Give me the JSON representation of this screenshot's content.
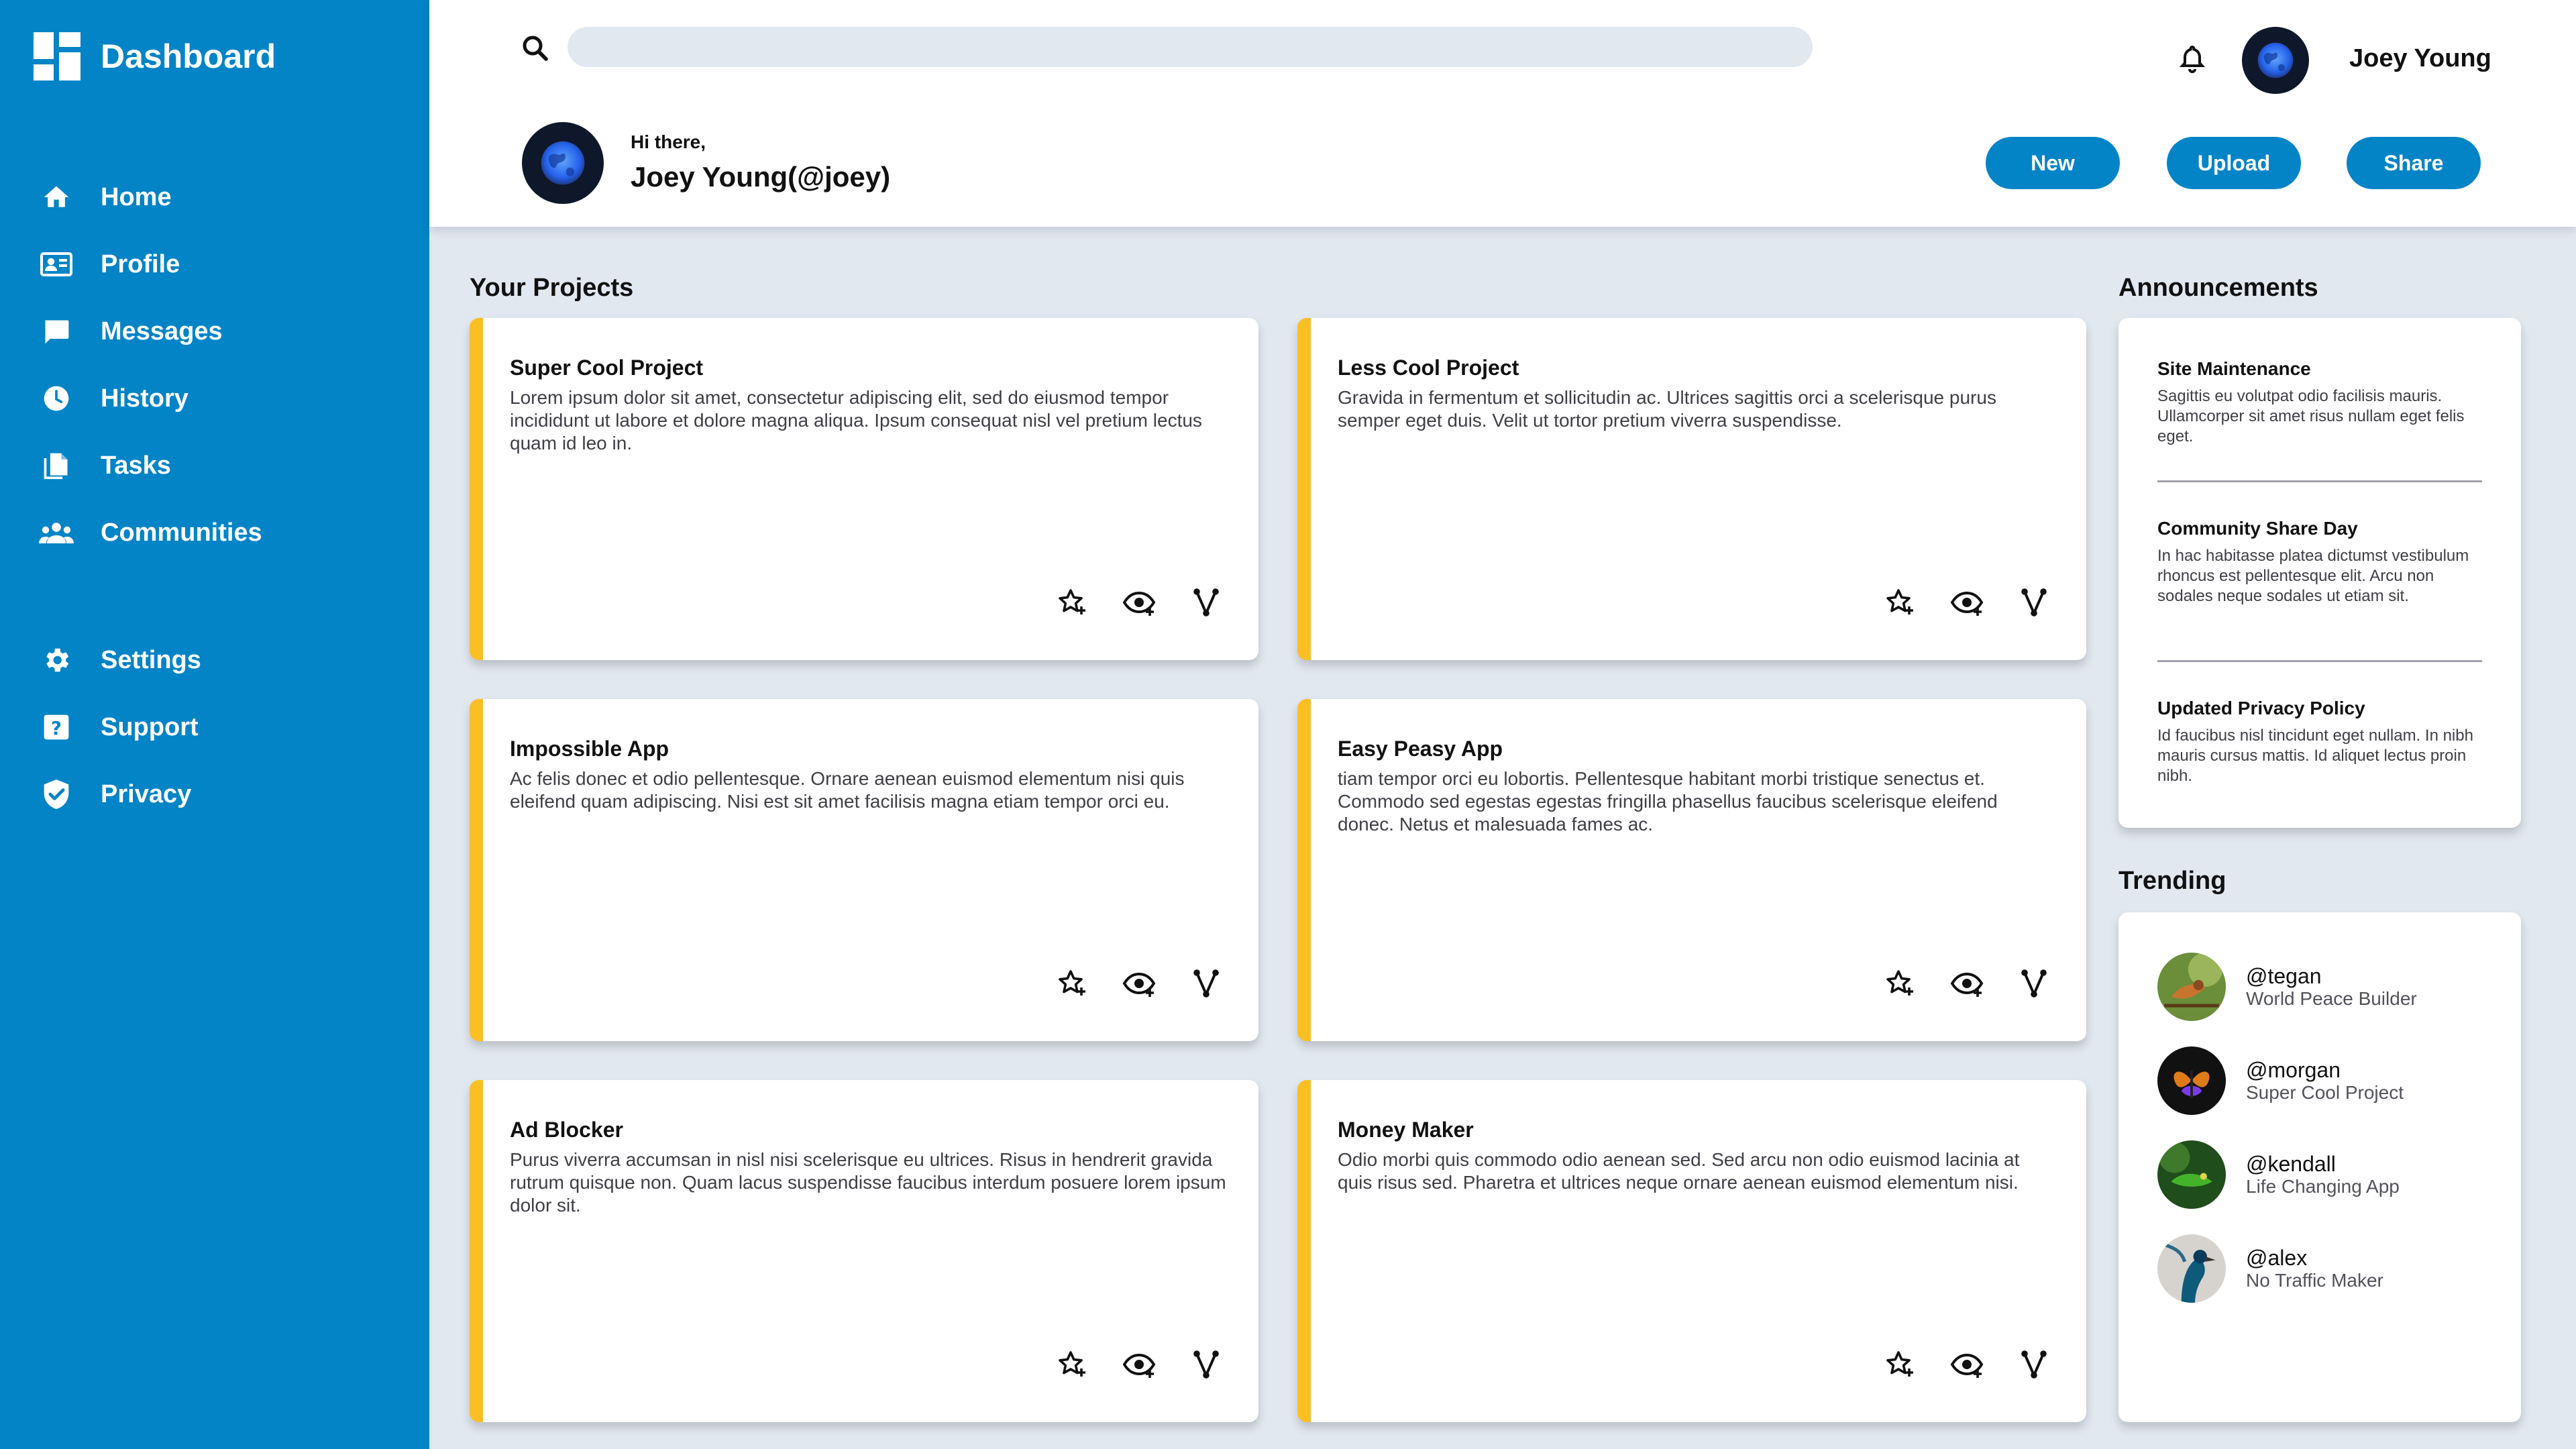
{
  "sidebar": {
    "brand": "Dashboard",
    "items": [
      {
        "label": "Home",
        "icon": "home-icon"
      },
      {
        "label": "Profile",
        "icon": "profile-card-icon"
      },
      {
        "label": "Messages",
        "icon": "message-icon"
      },
      {
        "label": "History",
        "icon": "clock-icon"
      },
      {
        "label": "Tasks",
        "icon": "documents-icon"
      },
      {
        "label": "Communities",
        "icon": "people-icon"
      }
    ],
    "bottom_items": [
      {
        "label": "Settings",
        "icon": "gear-icon"
      },
      {
        "label": "Support",
        "icon": "help-icon"
      },
      {
        "label": "Privacy",
        "icon": "shield-icon"
      }
    ]
  },
  "header": {
    "search": {
      "value": "",
      "placeholder": ""
    },
    "user_name": "Joey Young",
    "greeting_small": "Hi there,",
    "greeting_big": "Joey Young(@joey)",
    "buttons": {
      "new": "New",
      "upload": "Upload",
      "share": "Share"
    }
  },
  "projects": {
    "title": "Your Projects",
    "cards": [
      {
        "title": "Super Cool Project",
        "desc": "Lorem ipsum dolor sit amet, consectetur adipiscing elit, sed do eiusmod tempor incididunt ut labore et dolore magna aliqua. Ipsum consequat nisl vel pretium lectus quam id leo in."
      },
      {
        "title": "Less Cool Project",
        "desc": "Gravida in fermentum et sollicitudin ac. Ultrices sagittis orci a scelerisque purus semper eget duis. Velit ut tortor pretium viverra suspendisse."
      },
      {
        "title": "Impossible App",
        "desc": "Ac felis donec et odio pellentesque. Ornare aenean euismod elementum nisi quis eleifend quam adipiscing. Nisi est sit amet facilisis magna etiam tempor orci eu."
      },
      {
        "title": "Easy Peasy App",
        "desc": "tiam tempor orci eu lobortis. Pellentesque habitant morbi tristique senectus et. Commodo sed egestas egestas fringilla phasellus faucibus scelerisque eleifend donec. Netus et malesuada fames ac."
      },
      {
        "title": "Ad Blocker",
        "desc": "Purus viverra accumsan in nisl nisi scelerisque eu ultrices. Risus in hendrerit gravida rutrum quisque non. Quam lacus suspendisse faucibus interdum posuere lorem ipsum dolor sit."
      },
      {
        "title": "Money Maker",
        "desc": "Odio morbi quis commodo odio aenean sed. Sed arcu non odio euismod lacinia at quis risus sed. Pharetra et ultrices neque ornare aenean euismod elementum nisi."
      }
    ]
  },
  "announcements": {
    "title": "Announcements",
    "items": [
      {
        "title": "Site Maintenance",
        "text": "Sagittis eu volutpat odio facilisis mauris. Ullamcorper sit amet risus nullam eget felis eget."
      },
      {
        "title": "Community Share Day",
        "text": "In hac habitasse platea dictumst vestibulum rhoncus est pellentesque elit. Arcu non sodales neque sodales ut etiam sit."
      },
      {
        "title": "Updated Privacy Policy",
        "text": "Id faucibus nisl tincidunt eget nullam. In nibh mauris cursus mattis. Id aliquet lectus proin nibh."
      }
    ]
  },
  "trending": {
    "title": "Trending",
    "items": [
      {
        "handle": "@tegan",
        "project": "World Peace Builder"
      },
      {
        "handle": "@morgan",
        "project": "Super Cool Project"
      },
      {
        "handle": "@kendall",
        "project": "Life Changing App"
      },
      {
        "handle": "@alex",
        "project": "No Traffic Maker"
      }
    ]
  },
  "colors": {
    "sidebar": "#0284c7",
    "accent": "#fbbf24",
    "background": "#e2e8f0"
  }
}
